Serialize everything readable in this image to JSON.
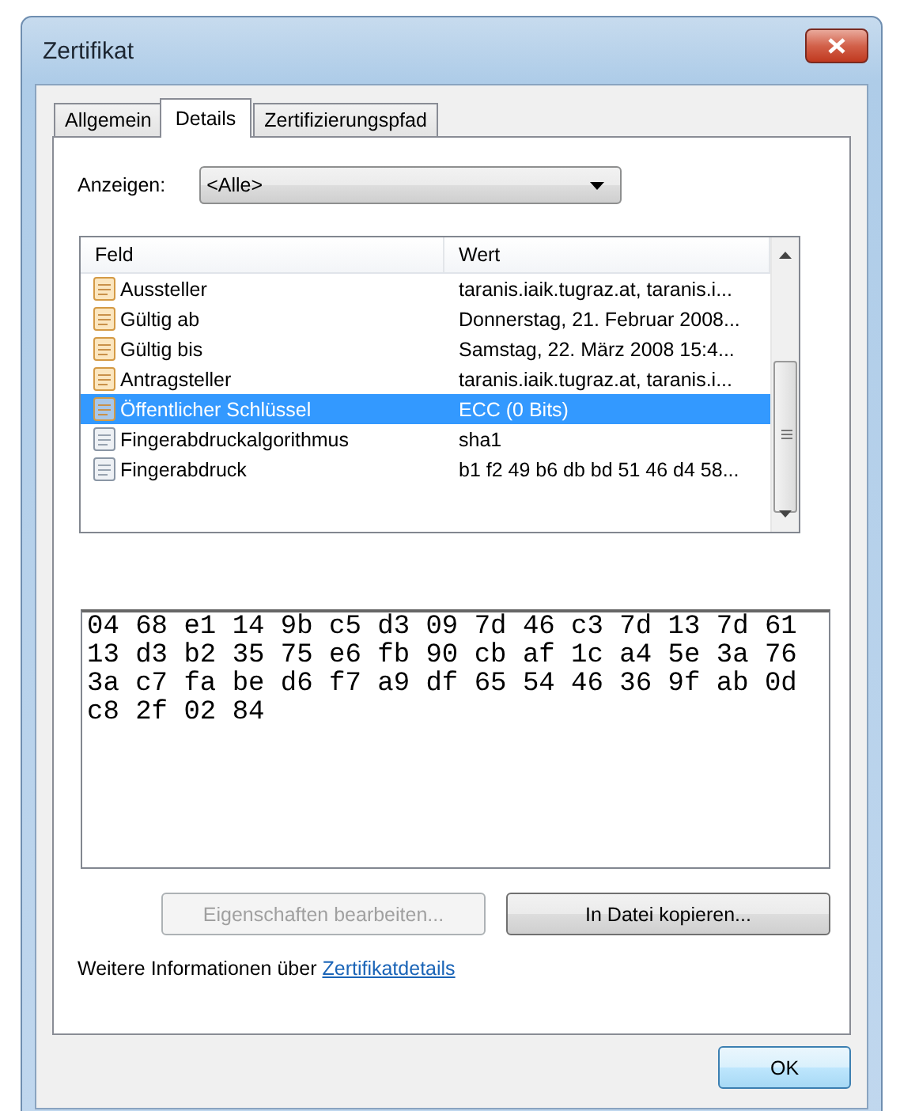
{
  "window": {
    "title": "Zertifikat"
  },
  "tabs": [
    {
      "label": "Allgemein",
      "selected": false
    },
    {
      "label": "Details",
      "selected": true
    },
    {
      "label": "Zertifizierungspfad",
      "selected": false
    }
  ],
  "show_filter": {
    "label": "Anzeigen:",
    "value": "<Alle>"
  },
  "field_list": {
    "columns": [
      "Feld",
      "Wert"
    ],
    "rows": [
      {
        "field": "Aussteller",
        "value": "taranis.iaik.tugraz.at, taranis.i...",
        "kind": "field",
        "selected": false
      },
      {
        "field": "Gültig ab",
        "value": "Donnerstag, 21. Februar 2008...",
        "kind": "field",
        "selected": false
      },
      {
        "field": "Gültig bis",
        "value": "Samstag, 22. März 2008 15:4...",
        "kind": "field",
        "selected": false
      },
      {
        "field": "Antragsteller",
        "value": "taranis.iaik.tugraz.at, taranis.i...",
        "kind": "field",
        "selected": false
      },
      {
        "field": "Öffentlicher Schlüssel",
        "value": "ECC (0 Bits)",
        "kind": "field",
        "selected": true
      },
      {
        "field": "Fingerabdruckalgorithmus",
        "value": "sha1",
        "kind": "property",
        "selected": false
      },
      {
        "field": "Fingerabdruck",
        "value": "b1 f2 49 b6 db bd 51 46 d4 58...",
        "kind": "property",
        "selected": false
      }
    ]
  },
  "value_box": {
    "value": "04 68 e1 14 9b c5 d3 09 7d 46 c3 7d 13 7d 61\n13 d3 b2 35 75 e6 fb 90 cb af 1c a4 5e 3a 76\n3a c7 fa be d6 f7 a9 df 65 54 46 36 9f ab 0d\nc8 2f 02 84"
  },
  "buttons": [
    {
      "label": "Eigenschaften bearbeiten...",
      "disabled": true
    },
    {
      "label": "In Datei kopieren...",
      "disabled": false
    }
  ],
  "info": {
    "text": "Weitere Informationen über",
    "link": "Zertifikatdetails"
  },
  "ok_button": {
    "label": "OK"
  }
}
